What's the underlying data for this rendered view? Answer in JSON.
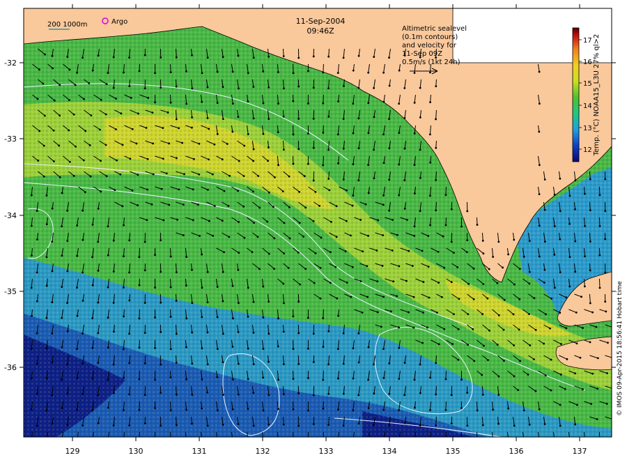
{
  "header": {
    "date": "11-Sep-2004",
    "time": "09:46Z"
  },
  "scale_legend": {
    "text": "200  1000m"
  },
  "argo_legend": {
    "text": "Argo"
  },
  "annotation": {
    "lines": [
      "Altimetric sealevel",
      "(0.1m contours)",
      "and velocity for",
      "11-Sep 09Z",
      "0.5m/s (1kt 24h)"
    ]
  },
  "colorbar": {
    "title": "Temp. (°C) NOAA15_L3U 27% ql>2",
    "ticks": [
      "12",
      "13",
      "14",
      "15",
      "16",
      "17"
    ],
    "colors": [
      "#0a0a6e",
      "#1040c8",
      "#20a0e0",
      "#20c880",
      "#50c030",
      "#c8e020",
      "#f0d020",
      "#f08020",
      "#c81010",
      "#500000"
    ]
  },
  "x_axis": {
    "ticks": [
      "129",
      "130",
      "131",
      "132",
      "133",
      "134",
      "135",
      "136",
      "137"
    ]
  },
  "y_axis": {
    "ticks": [
      "-32",
      "-33",
      "-34",
      "-35",
      "-36"
    ]
  },
  "credit": {
    "text": "© IMOS 09-Apr-2015 18:56:41 Hobart time"
  },
  "colors": {
    "land": "#f9c89b",
    "warm": "#e8e030",
    "mid": "#40b848",
    "cool": "#2090c8",
    "cold": "#0a1e8c"
  }
}
